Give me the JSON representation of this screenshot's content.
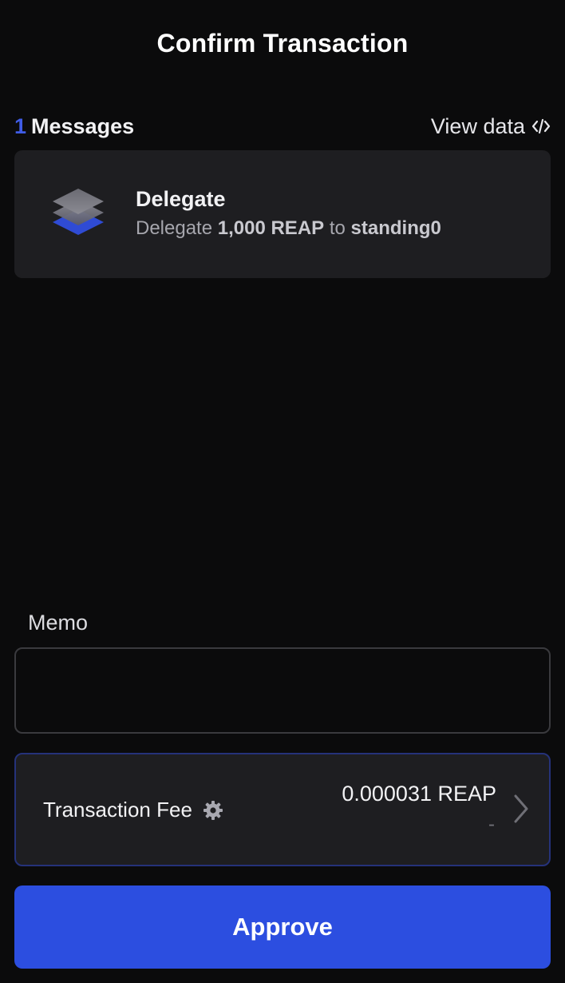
{
  "header": {
    "title": "Confirm Transaction"
  },
  "messages": {
    "count": "1",
    "label": "Messages",
    "view_data_label": "View data",
    "items": [
      {
        "icon": "stack-layers-icon",
        "title": "Delegate",
        "desc_prefix": "Delegate",
        "amount": "1,000 REAP",
        "desc_middle": "to",
        "validator": "standing0"
      }
    ]
  },
  "memo": {
    "label": "Memo",
    "value": "",
    "placeholder": ""
  },
  "fee": {
    "label": "Transaction Fee",
    "amount": "0.000031 REAP",
    "fiat": "-"
  },
  "actions": {
    "approve_label": "Approve"
  },
  "colors": {
    "accent": "#2c4ee0",
    "count_color": "#3f5ce6",
    "background": "#0b0b0c",
    "card": "#1e1e21"
  }
}
